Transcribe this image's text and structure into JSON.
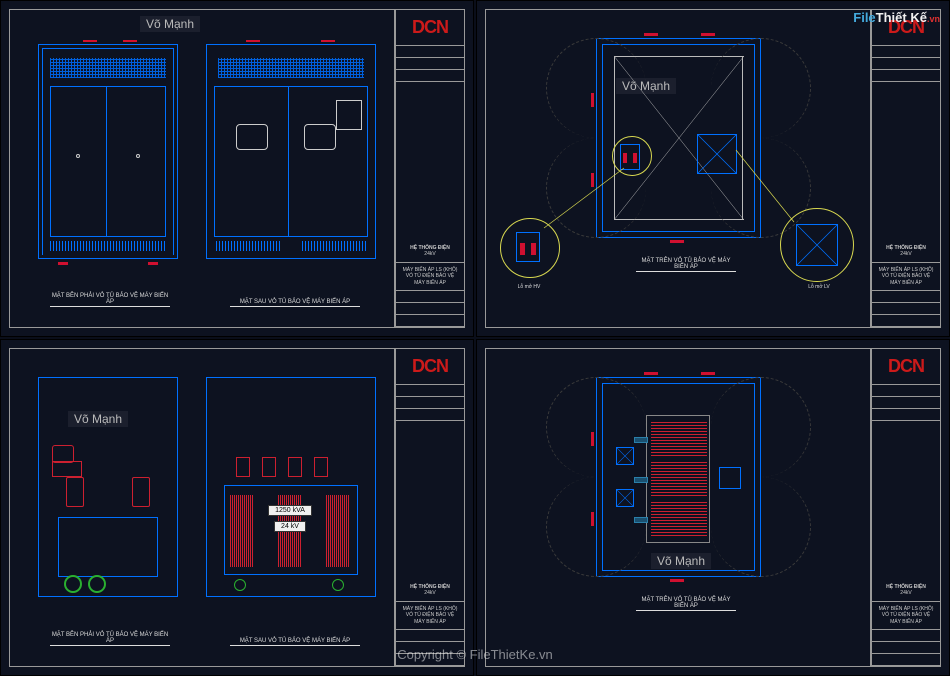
{
  "watermark": {
    "author": "Võ Mạnh",
    "site": "Copyright © FileThietKe.vn",
    "corner_file": "File",
    "corner_thiet": "Thiết",
    "corner_ke": "Kế",
    "corner_vn": ".vn"
  },
  "titleblock": {
    "logo": "DCN",
    "system_title": "HỆ THỐNG ĐIỆN",
    "system_voltage": "24kV",
    "equipment_line1": "MÁY BIẾN ÁP LS (KHÔ)",
    "equipment_line2": "VỎ TỦ ĐIỆN BẢO VỆ",
    "equipment_line3": "MÁY BIẾN ÁP"
  },
  "panel1": {
    "left_caption": "MẶT BÊN PHẢI VỎ TỦ BẢO VỆ MÁY BIẾN ÁP",
    "right_caption": "MẶT SAU VỎ TỦ BẢO VỆ MÁY BIẾN ÁP"
  },
  "panel2": {
    "caption": "MẶT TRÊN VỎ TỦ BẢO VỆ MÁY BIẾN ÁP",
    "detail_left": "Lỗ mở HV",
    "detail_right": "Lỗ mở LV"
  },
  "panel3": {
    "left_caption": "MẶT BÊN PHẢI VỎ TỦ BẢO VỆ MÁY BIẾN ÁP",
    "right_caption": "MẶT SAU VỎ TỦ BẢO VỆ MÁY BIẾN ÁP",
    "xfmr_rating": "1250 kVA",
    "xfmr_voltage": "24 kV"
  },
  "panel4": {
    "caption": "MẶT TRÊN VỎ TỦ BẢO VỆ MÁY BIẾN ÁP"
  }
}
